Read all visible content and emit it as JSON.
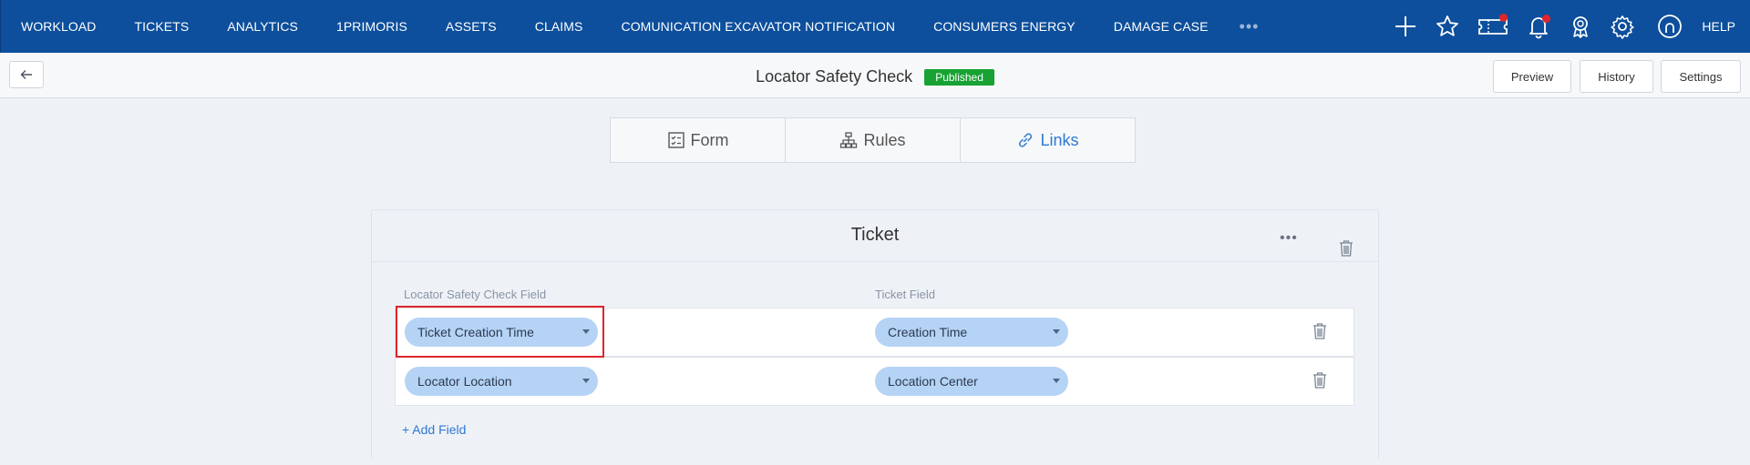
{
  "nav": {
    "items": [
      "WORKLOAD",
      "TICKETS",
      "ANALYTICS",
      "1PRIMORIS",
      "ASSETS",
      "CLAIMS",
      "COMUNICATION EXCAVATOR NOTIFICATION",
      "CONSUMERS ENERGY",
      "DAMAGE CASE"
    ],
    "more": "•••",
    "help": "HELP",
    "icons": [
      "plus-icon",
      "star-icon",
      "ticket-icon",
      "bell-icon",
      "award-icon",
      "gear-icon",
      "user-icon"
    ]
  },
  "toolbar": {
    "title": "Locator Safety Check",
    "status": "Published",
    "preview": "Preview",
    "history": "History",
    "settings": "Settings"
  },
  "tabs": [
    {
      "label": "Form"
    },
    {
      "label": "Rules"
    },
    {
      "label": "Links"
    }
  ],
  "card": {
    "title": "Ticket",
    "left_header": "Locator Safety Check Field",
    "right_header": "Ticket Field",
    "rows": [
      {
        "left": "Ticket Creation Time",
        "right": "Creation Time"
      },
      {
        "left": "Locator Location",
        "right": "Location Center"
      }
    ],
    "add_field": "+ Add Field"
  },
  "colors": {
    "nav_bg": "#0d4f9c",
    "accent": "#2f78d0",
    "published": "#17a233",
    "pill_bg": "#b5d3f5",
    "highlight": "#e0242b"
  }
}
